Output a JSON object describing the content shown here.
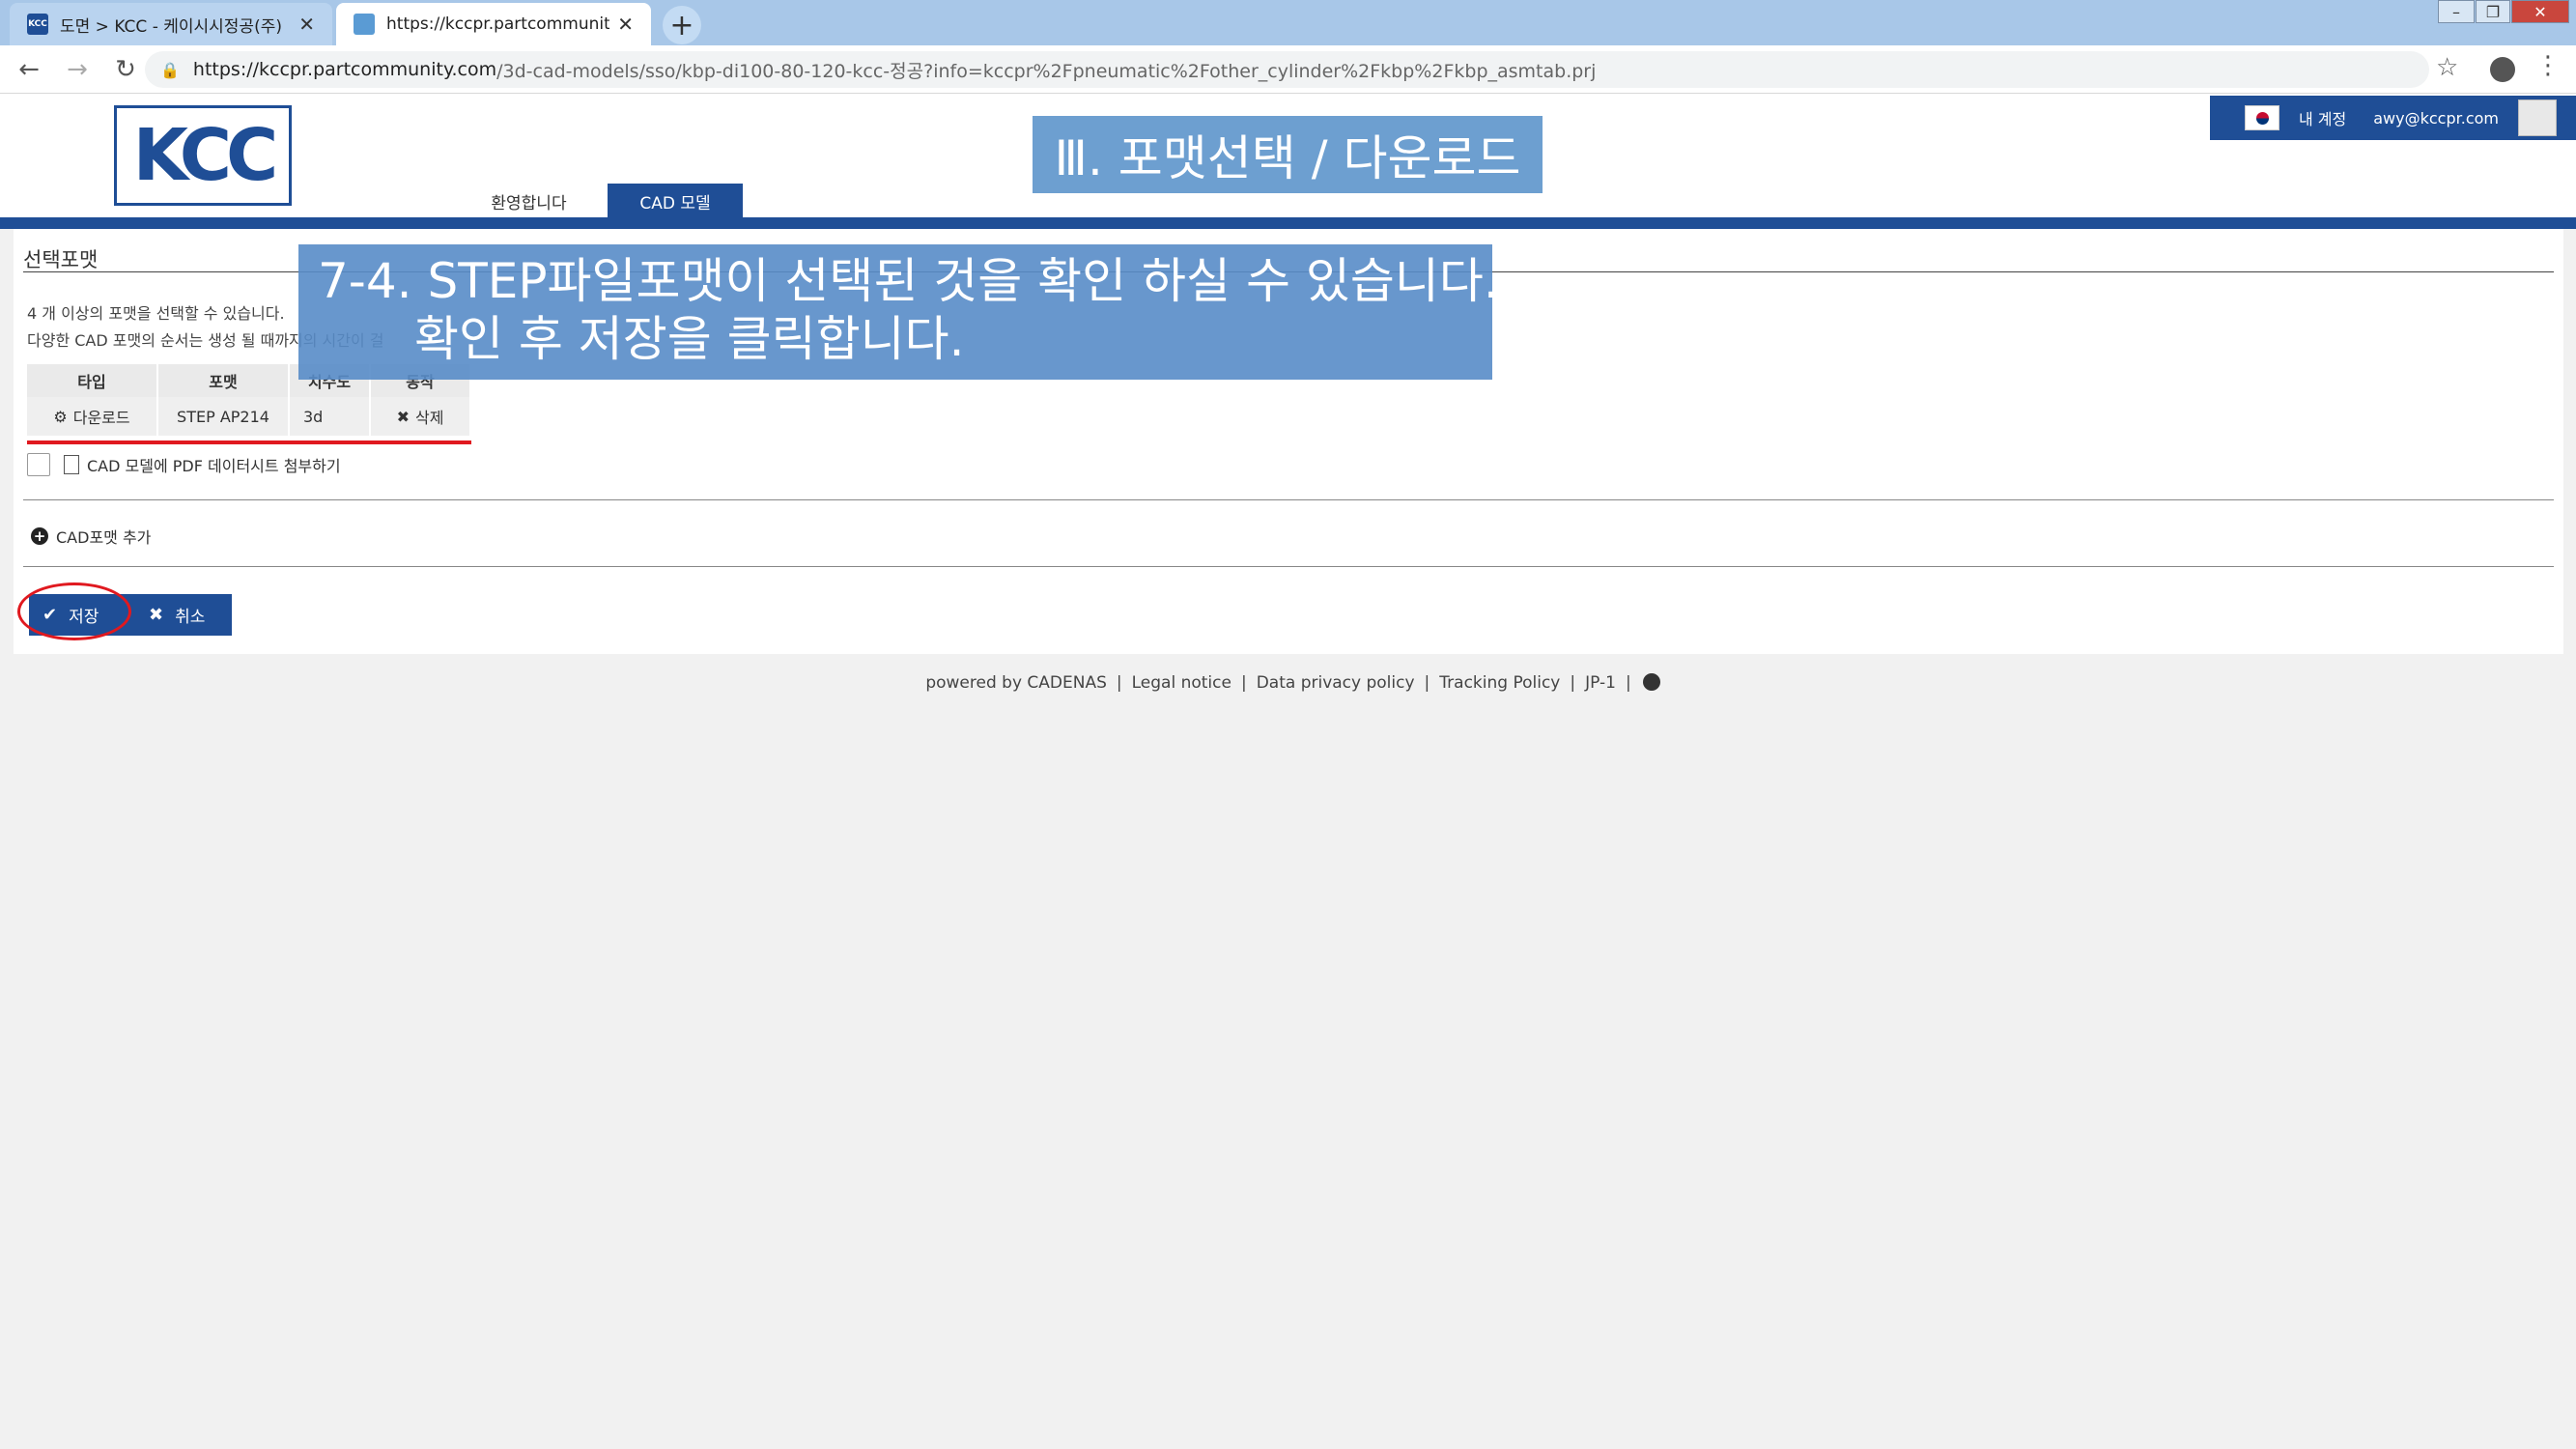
{
  "browser": {
    "tabs": [
      {
        "label": "도면 > KCC - 케이시시정공(주)",
        "favicon": "KCC",
        "active": false
      },
      {
        "label": "https://kccpr.partcommunity.com",
        "active": true
      }
    ],
    "url_host": "https://kccpr.partcommunity.com",
    "url_path": "/3d-cad-models/sso/kbp-di100-80-120-kcc-정공?info=kccpr%2Fpneumatic%2Fother_cylinder%2Fkbp%2Fkbp_asmtab.prj"
  },
  "header": {
    "logo": "KCC",
    "nav": {
      "welcome": "환영합니다",
      "cad": "CAD 모델"
    },
    "user": {
      "account": "내 계정",
      "email": "awy@kccpr.com"
    }
  },
  "banner": {
    "title": "Ⅲ. 포맷선택 / 다운로드"
  },
  "section": {
    "title": "선택포맷",
    "info_line1": "4 개 이상의 포맷을 선택할 수 있습니다.",
    "info_line2": "다양한 CAD 포맷의 순서는 생성 될 때까지의 시간이 걸"
  },
  "table": {
    "headers": [
      "타입",
      "포맷",
      "치수도",
      "동작"
    ],
    "row": {
      "type": "다운로드",
      "format": "STEP AP214",
      "dim": "3d",
      "action": "삭제"
    }
  },
  "checkbox": {
    "label": "CAD 모델에 PDF 데이터시트 첨부하기"
  },
  "add_format": {
    "label": "CAD포맷 추가"
  },
  "buttons": {
    "save": "저장",
    "cancel": "취소"
  },
  "overlay": {
    "line1": "7-4. STEP파일포맷이 선택된 것을 확인 하실 수 있습니다.",
    "line2": "확인 후 저장을 클릭합니다."
  },
  "footer": {
    "links": [
      "powered by CADENAS",
      "Legal notice",
      "Data privacy policy",
      "Tracking Policy",
      "JP-1"
    ]
  },
  "colors": {
    "brand": "#1f4e96",
    "highlight": "#e0191f",
    "overlay": "#588cc8"
  }
}
